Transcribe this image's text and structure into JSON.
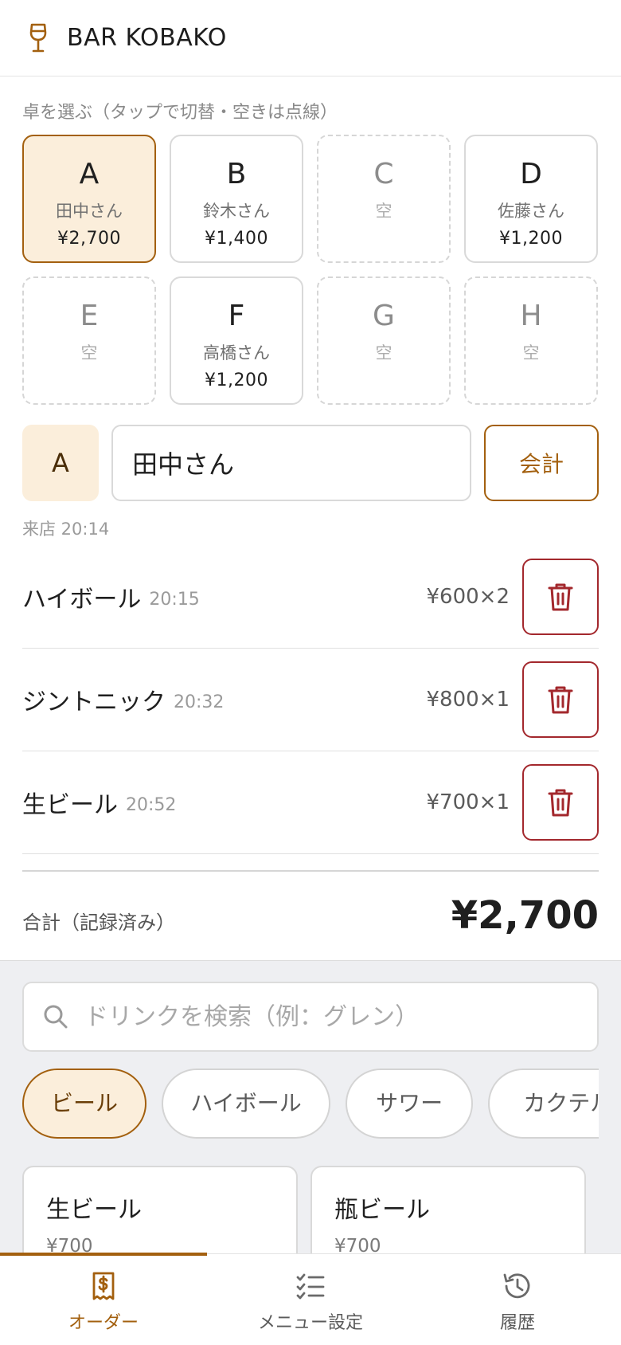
{
  "header": {
    "title": "BAR KOBAKO",
    "logo_icon": "wine-glass-icon"
  },
  "tables_section": {
    "label": "卓を選ぶ（タップで切替・空きは点線）",
    "tables": [
      {
        "letter": "A",
        "guest": "田中さん",
        "amount": "¥2,700",
        "state": "selected"
      },
      {
        "letter": "B",
        "guest": "鈴木さん",
        "amount": "¥1,400",
        "state": "occupied"
      },
      {
        "letter": "C",
        "guest": "空",
        "amount": "",
        "state": "empty"
      },
      {
        "letter": "D",
        "guest": "佐藤さん",
        "amount": "¥1,200",
        "state": "occupied"
      },
      {
        "letter": "E",
        "guest": "空",
        "amount": "",
        "state": "empty"
      },
      {
        "letter": "F",
        "guest": "高橋さん",
        "amount": "¥1,200",
        "state": "occupied"
      },
      {
        "letter": "G",
        "guest": "空",
        "amount": "",
        "state": "empty"
      },
      {
        "letter": "H",
        "guest": "空",
        "amount": "",
        "state": "empty"
      }
    ]
  },
  "current": {
    "table_letter": "A",
    "guest_name_value": "田中さん",
    "checkout_label": "会計",
    "arrival": "来店 20:14"
  },
  "orders": [
    {
      "name": "ハイボール",
      "time": "20:15",
      "qty": "¥600×2"
    },
    {
      "name": "ジントニック",
      "time": "20:32",
      "qty": "¥800×1"
    },
    {
      "name": "生ビール",
      "time": "20:52",
      "qty": "¥700×1"
    }
  ],
  "total": {
    "label": "合計（記録済み）",
    "value": "¥2,700"
  },
  "picker": {
    "search_placeholder": "ドリンクを検索（例：グレン）",
    "categories": [
      {
        "label": "ビール",
        "active": true
      },
      {
        "label": "ハイボール",
        "active": false
      },
      {
        "label": "サワー",
        "active": false
      },
      {
        "label": "カクテル",
        "active": false
      }
    ],
    "drinks": [
      {
        "name": "生ビール",
        "price": "¥700"
      },
      {
        "name": "瓶ビール",
        "price": "¥700"
      }
    ]
  },
  "nav": {
    "items": [
      {
        "label": "オーダー",
        "icon": "receipt-dollar-icon",
        "active": true
      },
      {
        "label": "メニュー設定",
        "icon": "checklist-icon",
        "active": false
      },
      {
        "label": "履歴",
        "icon": "history-icon",
        "active": false
      }
    ]
  },
  "colors": {
    "accent": "#a3600f",
    "accent_bg": "#fbeedb",
    "danger": "#a3282d"
  }
}
